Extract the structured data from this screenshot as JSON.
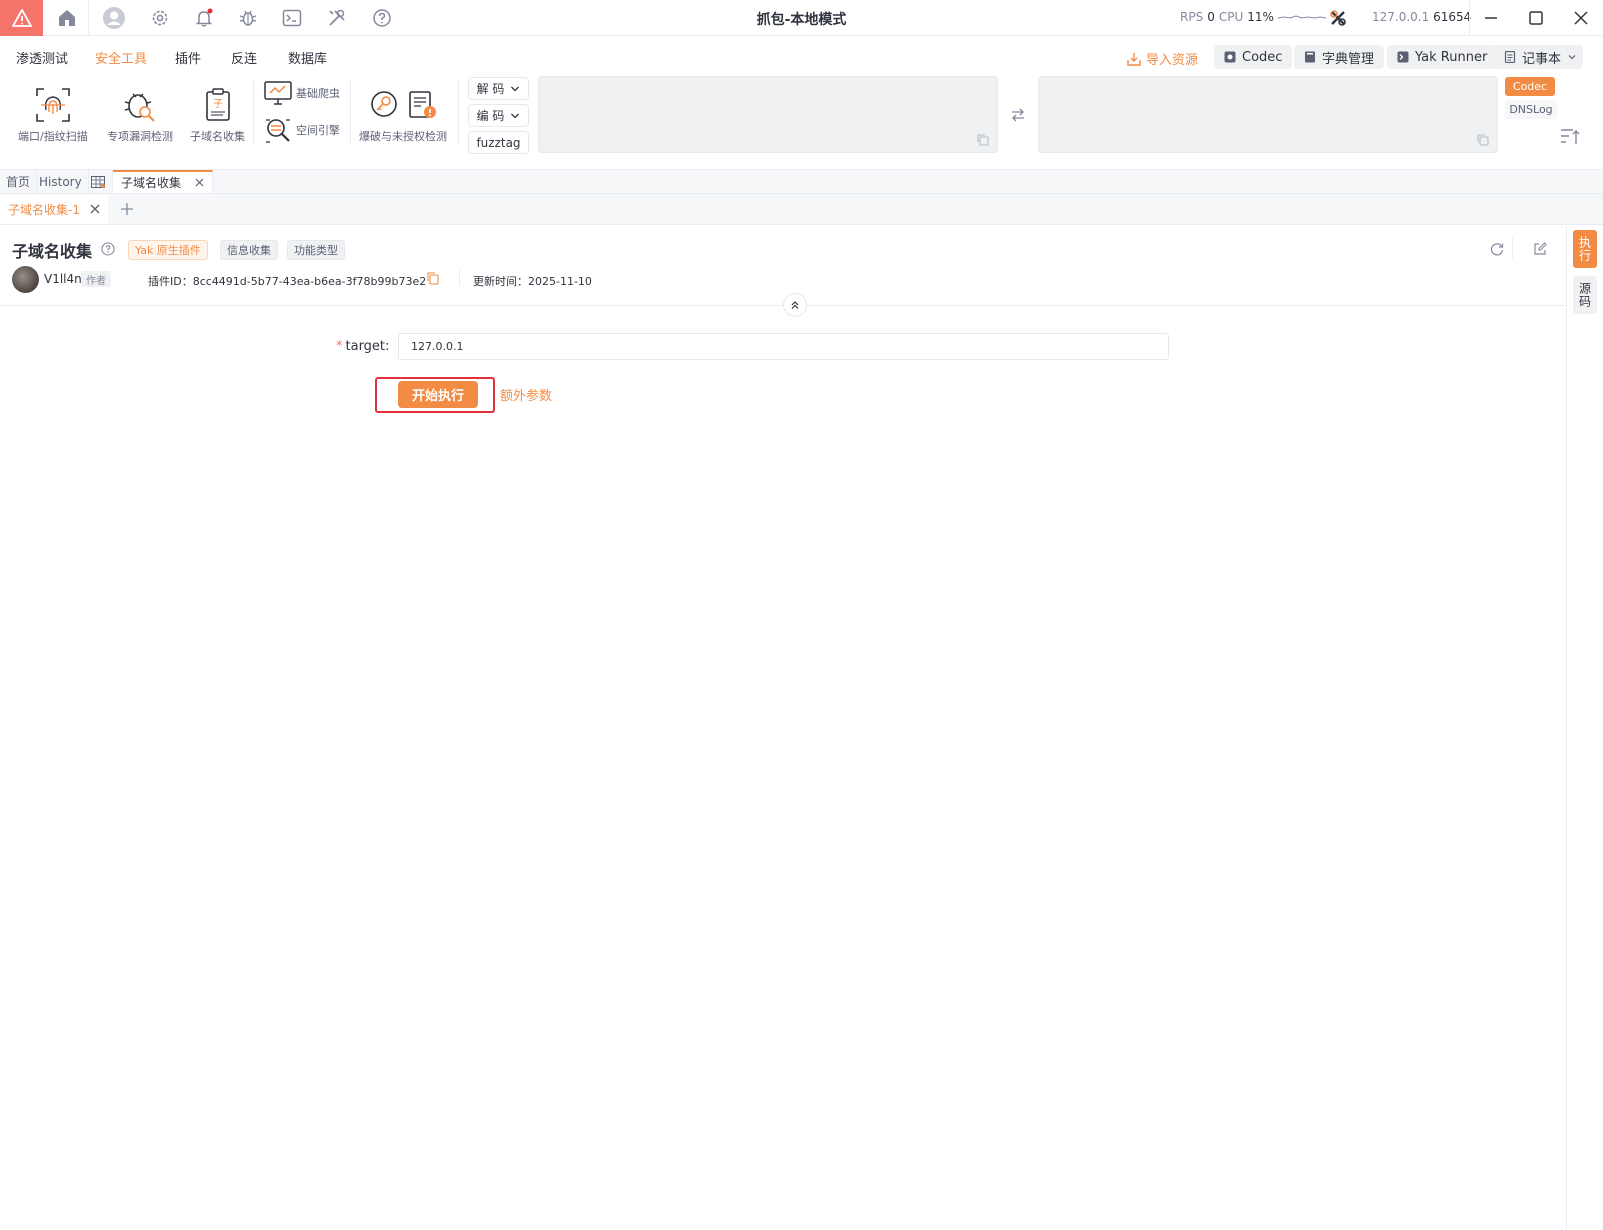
{
  "window": {
    "title": "抓包-本地模式",
    "rps_label": "RPS",
    "rps_value": "0",
    "cpu_label": "CPU",
    "cpu_value": "11%",
    "engine_host": "127.0.0.1",
    "engine_port": "61654"
  },
  "menu": {
    "items": [
      "渗透测试",
      "安全工具",
      "插件",
      "反连",
      "数据库"
    ],
    "active": "安全工具",
    "import_resource": "导入资源",
    "quick_buttons": [
      "Codec",
      "字典管理",
      "Yak Runner",
      "记事本"
    ]
  },
  "tools": {
    "port_scan": "端口/指纹扫描",
    "vuln_detect": "专项漏洞检测",
    "subdomain": "子域名收集",
    "crawler": "基础爬虫",
    "space_engine": "空间引擎",
    "brute": "爆破与未授权检测"
  },
  "codec": {
    "decode": "解 码",
    "encode": "编 码",
    "fuzztag": "fuzztag",
    "tab_codec": "Codec",
    "tab_dnslog": "DNSLog"
  },
  "tabs_main": [
    "首页",
    "History",
    "",
    "子域名收集"
  ],
  "tabs_sub": [
    "子域名收集-1"
  ],
  "plugin": {
    "title": "子域名收集",
    "tags": [
      "Yak 原生插件",
      "信息收集",
      "功能类型"
    ],
    "author": "V1ll4n",
    "author_badge": "作者",
    "plugin_id": "插件ID：8cc4491d-5b77-43ea-b6ea-3f78b99b73e2",
    "update_time": "更新时间：2025-11-10"
  },
  "form": {
    "target_label": "target",
    "target_value": "127.0.0.1",
    "start_button": "开始执行",
    "extra_params": "额外参数"
  },
  "rail": {
    "exec": "执行",
    "source": "源码"
  },
  "colors": {
    "accent": "#f28b44",
    "alert": "#f4736b",
    "highlight": "#e2303a"
  }
}
